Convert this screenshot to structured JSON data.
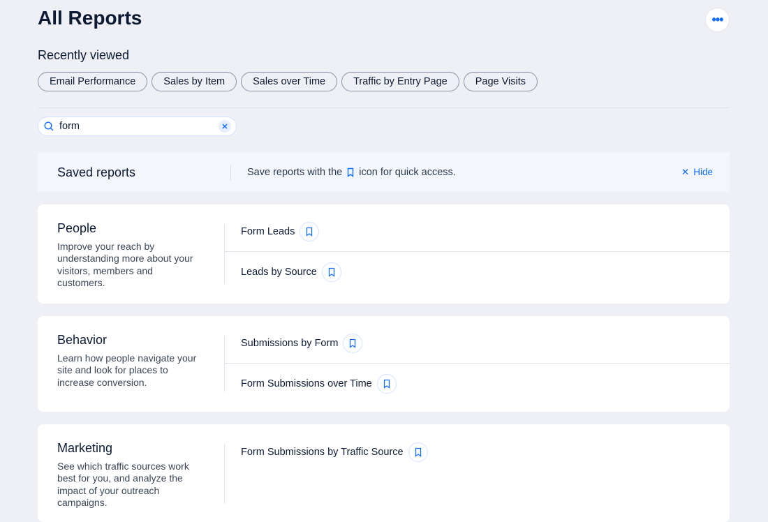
{
  "header": {
    "title": "All Reports",
    "more_icon": "ellipsis-icon"
  },
  "recent": {
    "label": "Recently viewed",
    "items": [
      "Email Performance",
      "Sales by Item",
      "Sales over Time",
      "Traffic by Entry Page",
      "Page Visits"
    ]
  },
  "search": {
    "value": "form"
  },
  "banner": {
    "title": "Saved reports",
    "msg_before": "Save reports with the",
    "msg_after": "icon for quick access.",
    "hide": "Hide"
  },
  "colors": {
    "accent": "#116dff",
    "background": "#eef0f5"
  },
  "sections": [
    {
      "title": "People",
      "desc": "Improve your reach by understanding more about your visitors, members and customers.",
      "reports": [
        "Form Leads",
        "Leads by Source"
      ]
    },
    {
      "title": "Behavior",
      "desc": "Learn how people navigate your site and look for places to increase conversion.",
      "reports": [
        "Submissions by Form",
        "Form Submissions over Time"
      ]
    },
    {
      "title": "Marketing",
      "desc": "See which traffic sources work best for you, and analyze the impact of your outreach campaigns.",
      "reports": [
        "Form Submissions by Traffic Source"
      ]
    }
  ]
}
